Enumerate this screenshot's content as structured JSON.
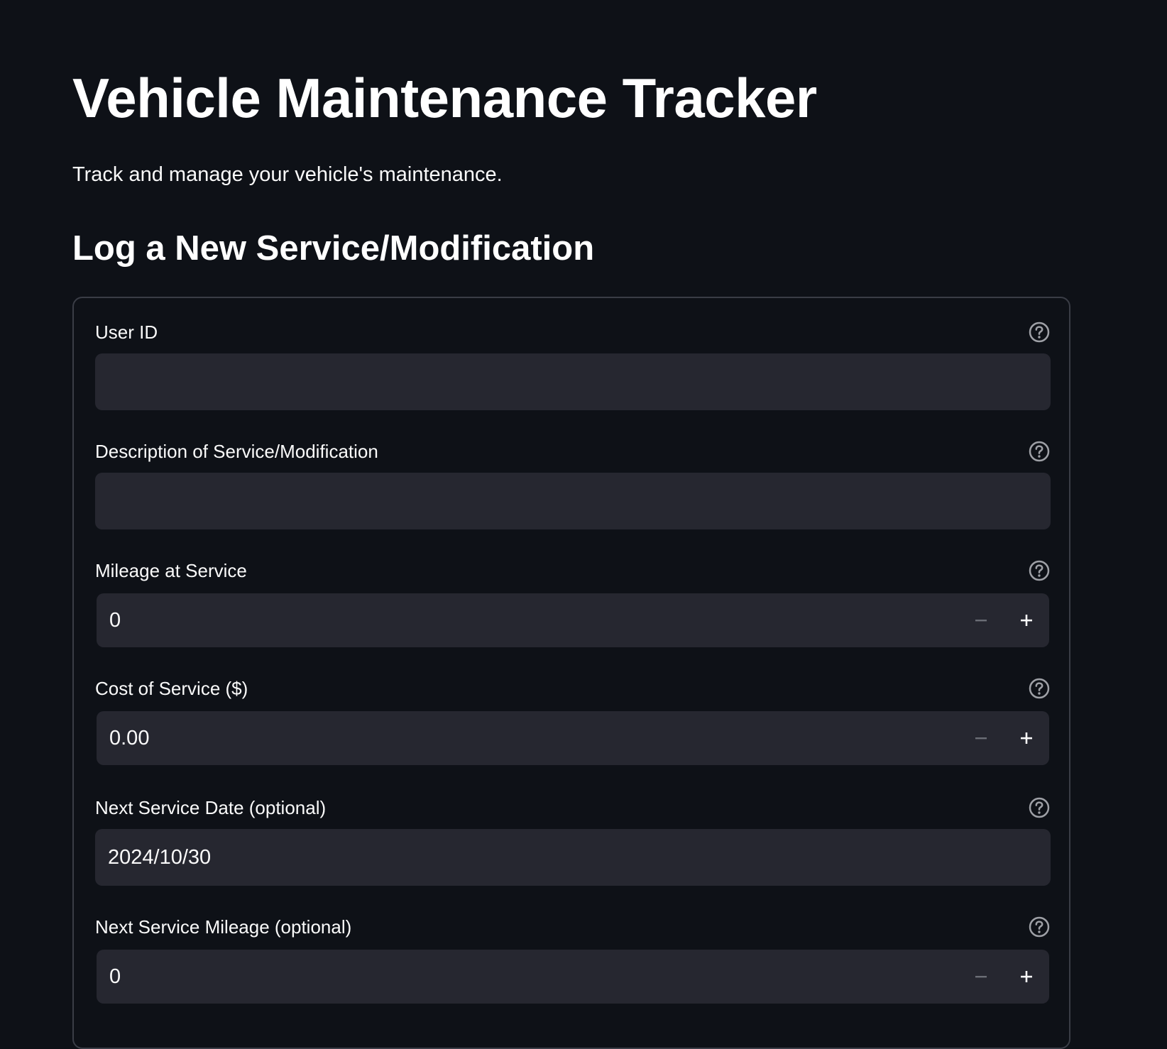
{
  "header": {
    "title": "Vehicle Maintenance Tracker",
    "subtitle": "Track and manage your vehicle's maintenance."
  },
  "form": {
    "section_title": "Log a New Service/Modification",
    "fields": [
      {
        "label": "User ID",
        "value": "",
        "type": "text",
        "help_icon": "question-circle-icon"
      },
      {
        "label": "Description of Service/Modification",
        "value": "",
        "type": "text",
        "help_icon": "question-circle-icon"
      },
      {
        "label": "Mileage at Service",
        "value": "0",
        "type": "number",
        "help_icon": "question-circle-icon"
      },
      {
        "label": "Cost of Service ($)",
        "value": "0.00",
        "type": "number",
        "help_icon": "question-circle-icon"
      },
      {
        "label": "Next Service Date (optional)",
        "value": "2024/10/30",
        "type": "date",
        "help_icon": "question-circle-icon"
      },
      {
        "label": "Next Service Mileage (optional)",
        "value": "0",
        "type": "number",
        "help_icon": "question-circle-icon"
      }
    ]
  },
  "colors": {
    "background": "#0e1117",
    "input_background": "#262730",
    "border": "#3a3d46",
    "text": "#fafafa",
    "icon": "#9ea0a6"
  }
}
